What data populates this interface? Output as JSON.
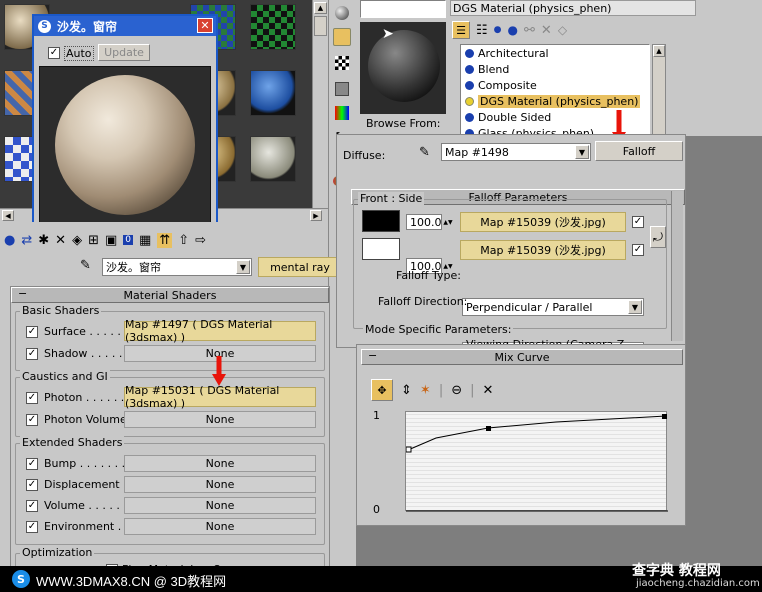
{
  "popup": {
    "title": "沙发。窗帘",
    "auto_label": "Auto",
    "update_label": "Update"
  },
  "browser": {
    "title": "DGS Material (physics_phen)",
    "browse_from": "Browse From:",
    "list": [
      "Architectural",
      "Blend",
      "Composite",
      "DGS Material (physics_phen)",
      "Double Sided",
      "Glass (physics_phen)"
    ]
  },
  "editor": {
    "material_name": "沙发。窗帘",
    "material_type": "mental ray"
  },
  "material_shaders": {
    "title": "Material Shaders",
    "basic": {
      "title": "Basic Shaders",
      "surface_label": "Surface . . . . .",
      "surface_value": "Map #1497  ( DGS Material (3dsmax) )",
      "shadow_label": "Shadow . . . . .",
      "shadow_value": "None"
    },
    "caustics": {
      "title": "Caustics and GI",
      "photon_label": "Photon . . . . . .",
      "photon_value": "Map #15031  ( DGS Material (3dsmax) )",
      "photon_volume_label": "Photon Volume",
      "photon_volume_value": "None"
    },
    "extended": {
      "title": "Extended Shaders",
      "bump_label": "Bump . . . . . . . .",
      "bump_value": "None",
      "displacement_label": "Displacement . .",
      "displacement_value": "None",
      "volume_label": "Volume . . . . . .",
      "volume_value": "None",
      "environment_label": "Environment . . .",
      "environment_value": "None"
    },
    "optimization": {
      "title": "Optimization",
      "flag_label": "Flag Material as Opaque"
    }
  },
  "falloff": {
    "diffuse_label": "Diffuse:",
    "map_name": "Map #1498",
    "type_button": "Falloff",
    "params_title": "Falloff Parameters",
    "front_side": "Front : Side",
    "amount1": "100.0",
    "map1": "Map #15039 (沙发.jpg)",
    "amount2": "100.0",
    "map2": "Map #15039 (沙发.jpg)",
    "falloff_type_label": "Falloff Type:",
    "falloff_type_value": "Perpendicular / Parallel",
    "falloff_direction_label": "Falloff Direction:",
    "falloff_direction_value": "Viewing Direction (Camera Z-Axis)",
    "mode_specific": "Mode Specific Parameters:"
  },
  "mix_curve": {
    "title": "Mix Curve",
    "y_top": "1",
    "y_bottom": "0"
  },
  "footer": {
    "watermark": "WWW.3DMAX8.CN @ 3D教程网",
    "site_cn": "查字典 教程网",
    "site_url": "jiaocheng.chazidian.com"
  },
  "colors": {
    "highlight": "#e8d89a",
    "red_arrow": "#e8140a",
    "panel": "#c8c8c8"
  }
}
